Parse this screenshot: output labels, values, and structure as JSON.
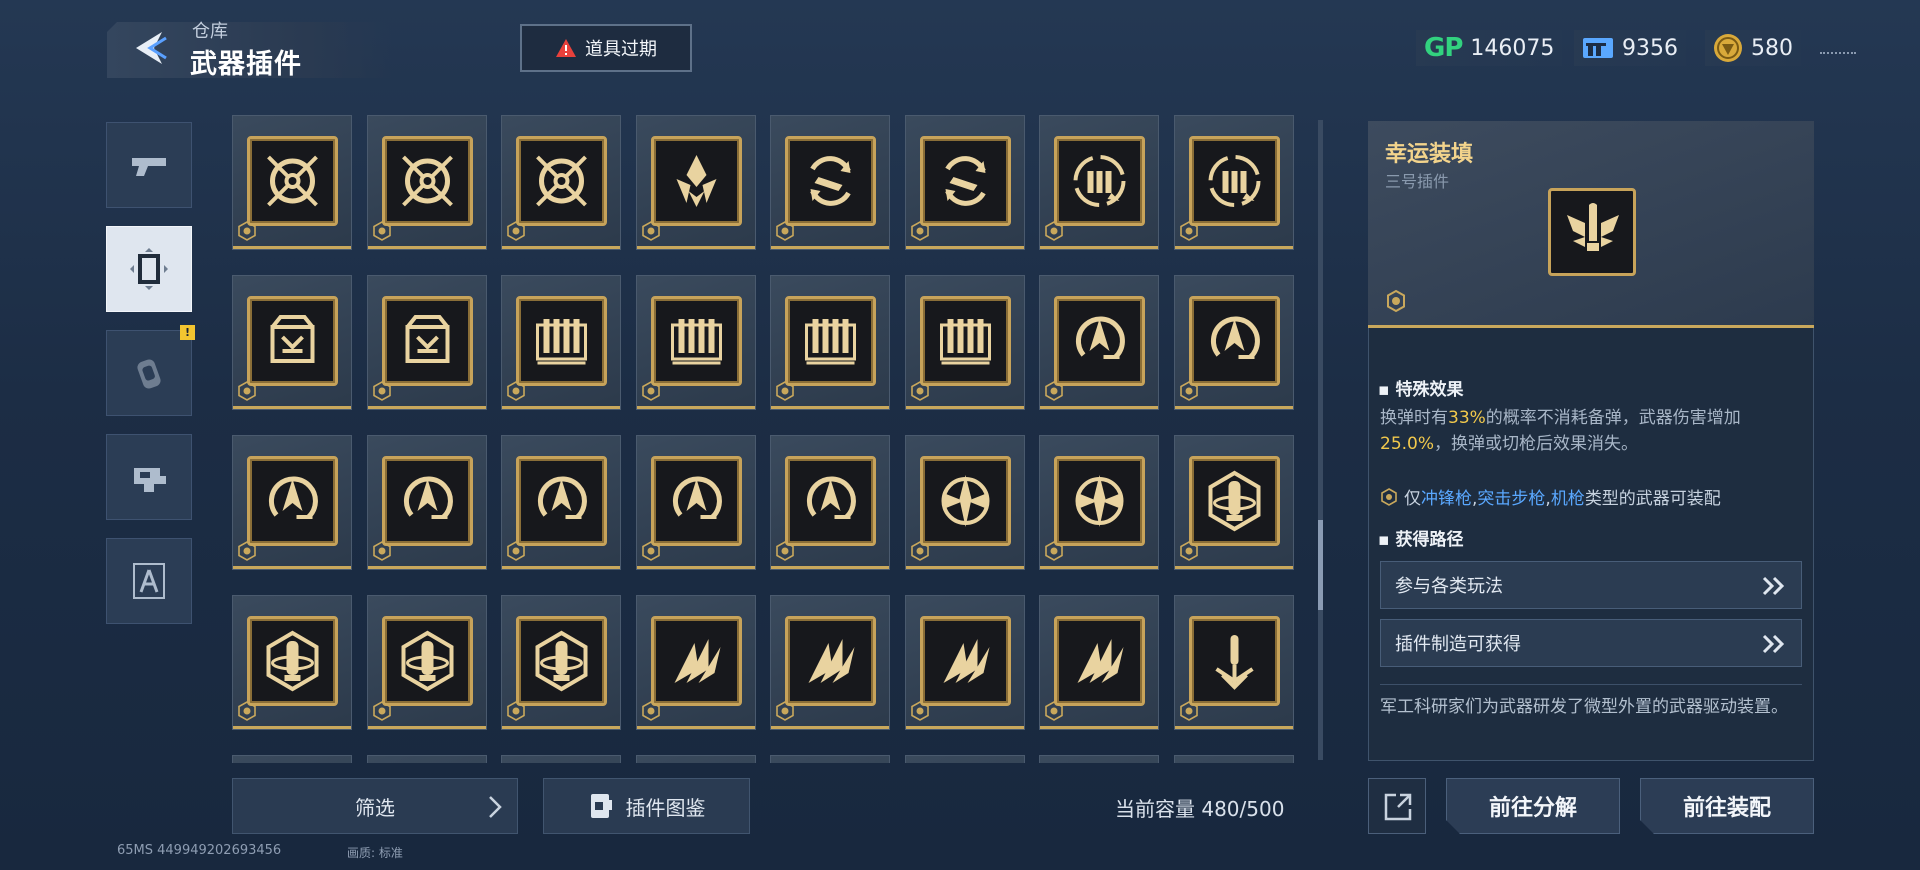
{
  "header": {
    "breadcrumb": "仓库",
    "title": "武器插件",
    "expired_label": "道具过期"
  },
  "currency": [
    {
      "icon": "gp-icon",
      "prefix": "GP",
      "value": "146075"
    },
    {
      "icon": "ticket-icon",
      "value": "9356"
    },
    {
      "icon": "coin-icon",
      "value": "580"
    }
  ],
  "tabs": [
    {
      "name": "weapon",
      "icon": "gun-icon"
    },
    {
      "name": "plugin",
      "icon": "plugin-icon",
      "active": true
    },
    {
      "name": "consumable",
      "icon": "grenade-icon",
      "alert": "!"
    },
    {
      "name": "attachment",
      "icon": "attachment-icon"
    },
    {
      "name": "blueprint",
      "icon": "compass-icon"
    }
  ],
  "grid": {
    "items": [
      "target-icon",
      "target-icon",
      "target-icon",
      "crystal-icon",
      "bullet-swap-icon",
      "bullet-swap-icon",
      "ammo-cycle-icon",
      "ammo-cycle-icon",
      "crate-icon",
      "crate-icon",
      "magazine-icon",
      "magazine-icon",
      "magazine-icon",
      "magazine-icon",
      "arrow-circle-icon",
      "arrow-circle-icon",
      "arrow-circle-icon",
      "arrow-circle-icon",
      "arrow-circle-icon",
      "arrow-circle-icon",
      "arrow-circle-icon",
      "compass-star-icon",
      "compass-star-icon",
      "shell-hex-icon",
      "shell-hex-icon",
      "shell-hex-icon",
      "shell-hex-icon",
      "claw-icon",
      "claw-icon",
      "claw-icon",
      "claw-icon",
      "bullet-wing-icon"
    ]
  },
  "bottom": {
    "filter_label": "筛选",
    "codex_label": "插件图鉴",
    "capacity_label": "当前容量 480/500",
    "ping": "65MS  449949202693456",
    "quality": "画质: 标准"
  },
  "detail": {
    "name": "幸运装填",
    "subtitle": "三号插件",
    "effect_title": "特殊效果",
    "effect": {
      "t1": "换弹时有",
      "v1": "33%",
      "t2": "的概率不消耗备弹，武器伤害增加",
      "v2": "25.0%",
      "t3": "，换弹或切枪后效果消失。"
    },
    "equip": {
      "prefix": "仅",
      "t1": "冲锋枪",
      "sep1": ",",
      "t2": "突击步枪",
      "sep2": ",",
      "t3": "机枪",
      "suffix": "类型的武器可装配"
    },
    "source_title": "获得路径",
    "routes": [
      "参与各类玩法",
      "插件制造可获得"
    ],
    "description": "军工科研家们为武器研发了微型外置的武器驱动装置。",
    "decompose_label": "前往分解",
    "equip_label": "前往装配"
  },
  "colors": {
    "gold": "#c9a85c",
    "highlight": "#f2c94c",
    "weapon_type": "#5aa8ff",
    "gp": "#32d27f"
  }
}
